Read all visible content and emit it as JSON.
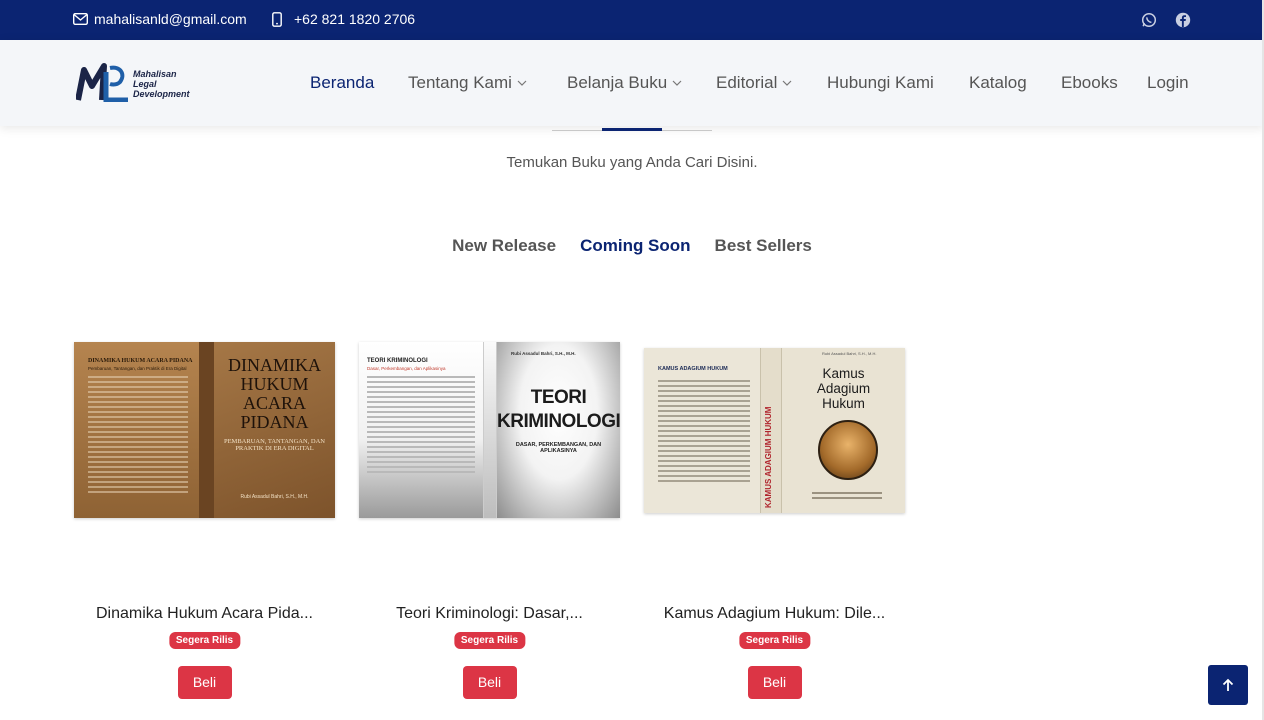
{
  "topbar": {
    "email": "mahalisanld@gmail.com",
    "phone": "+62 821 1820 2706",
    "email_icon": "envelope-icon",
    "phone_icon": "phone-icon",
    "social": [
      "whatsapp-icon",
      "facebook-icon"
    ]
  },
  "brand": {
    "name_line1": "Mahalisan",
    "name_line2": "Legal",
    "name_line3": "Development"
  },
  "nav": {
    "beranda": "Beranda",
    "tentang": "Tentang Kami",
    "belanja": "Belanja Buku",
    "editorial": "Editorial",
    "hubungi": "Hubungi Kami",
    "katalog": "Katalog",
    "ebooks": "Ebooks",
    "login": "Login"
  },
  "section": {
    "subtitle": "Temukan Buku yang Anda Cari Disini."
  },
  "tabs": [
    "New Release",
    "Coming Soon",
    "Best Sellers"
  ],
  "active_tab": "Coming Soon",
  "books": [
    {
      "title": "Dinamika Hukum Acara Pida...",
      "badge": "Segera Rilis",
      "button": "Beli",
      "cover": {
        "back_title": "DINAMIKA HUKUM ACARA PIDANA",
        "back_sub": "Pembaruan, Tantangan, dan Praktik di Era Digital",
        "front_line1": "DINAMIKA",
        "front_line2": "HUKUM",
        "front_line3": "ACARA",
        "front_line4": "PIDANA",
        "front_sub1": "PEMBARUAN, TANTANGAN, DAN",
        "front_sub2": "PRAKTIK DI ERA DIGITAL",
        "author": "Rubi Assadul Bahri, S.H., M.H."
      }
    },
    {
      "title": "Teori Kriminologi: Dasar,...",
      "badge": "Segera Rilis",
      "button": "Beli",
      "cover": {
        "back_title": "TEORI KRIMINOLOGI",
        "back_sub": "Dasar, Perkembangan, dan Aplikasinya",
        "author": "Rubi Assadul Bahri, S.H., M.H.",
        "front_line1": "TEORI",
        "front_line2": "KRIMINOLOGI",
        "front_sub1": "DASAR, PERKEMBANGAN, DAN",
        "front_sub2": "APLIKASINYA"
      }
    },
    {
      "title": "Kamus Adagium Hukum: Dile...",
      "badge": "Segera Rilis",
      "button": "Beli",
      "cover": {
        "back_title": "KAMUS ADAGIUM HUKUM",
        "spine": "KAMUS ADAGIUM HUKUM",
        "author": "Rubi Assadul Bahri, S.H., M.H.",
        "front_line1": "Kamus",
        "front_line2": "Adagium",
        "front_line3": "Hukum"
      }
    }
  ],
  "colors": {
    "primary": "#0b2472",
    "badge": "#dc3545",
    "header_bg": "#f4f6f9"
  },
  "back_to_top_icon": "arrow-up-icon"
}
